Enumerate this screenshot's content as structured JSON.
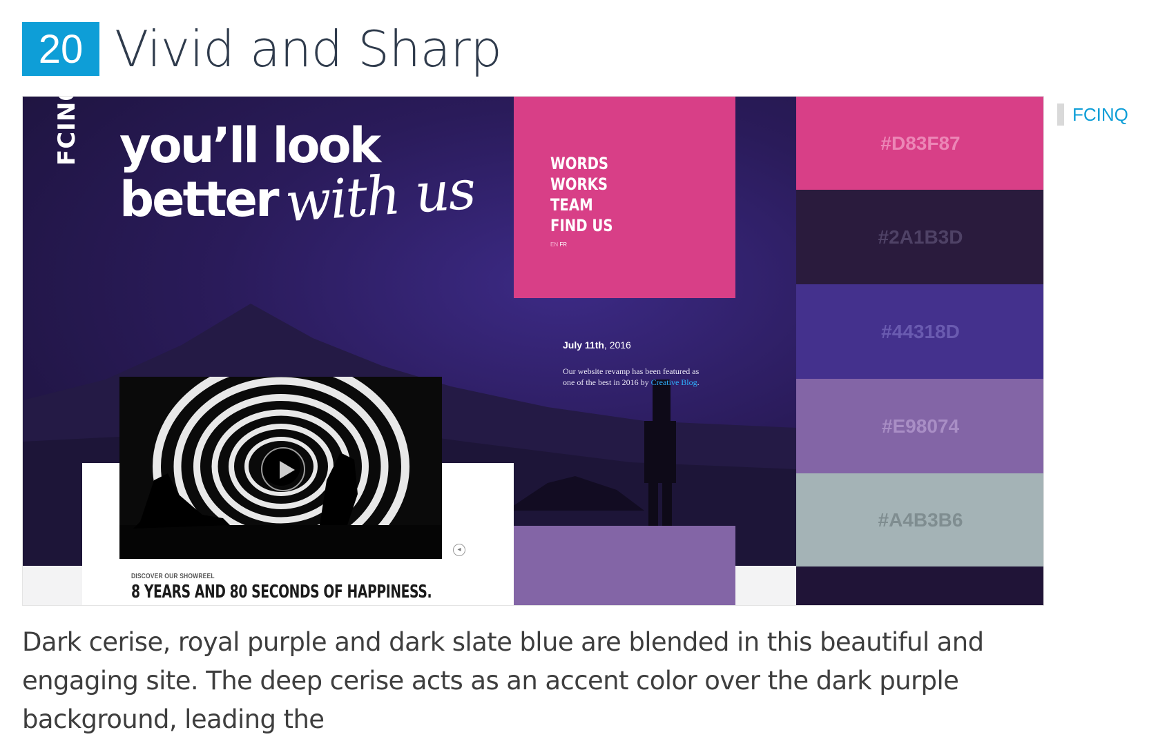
{
  "header": {
    "number": "20",
    "title": "Vivid and Sharp"
  },
  "screenshot": {
    "brand": "FCINQ",
    "headline_line1": "you’ll look",
    "headline_line2": "better",
    "headline_script": "with us",
    "menu": [
      "WORDS",
      "WORKS",
      "TEAM",
      "FIND US"
    ],
    "lang_en": "EN",
    "lang_fr": "FR",
    "news_date_bold": "July 11th",
    "news_date_rest": ", 2016",
    "news_text_before": "Our website revamp has been featured as one of the best in 2016 by ",
    "news_link": "Creative Blog",
    "news_text_after": ".",
    "reel_kicker": "DISCOVER OUR SHOWREEL",
    "reel_title": "8 YEARS AND 80 SECONDS OF HAPPINESS."
  },
  "swatches": [
    {
      "label": "#D83F87",
      "bg": "#D83F87",
      "text_color": "#ec86b6"
    },
    {
      "label": "#2A1B3D",
      "bg": "#2A1B3D",
      "text_color": "#4f4266"
    },
    {
      "label": "#44318D",
      "bg": "#44318D",
      "text_color": "#6a5bb0"
    },
    {
      "label": "#E98074",
      "bg": "#8365A6",
      "text_color": "#a98ec5"
    },
    {
      "label": "#A4B3B6",
      "bg": "#A4B3B6",
      "text_color": "#7f8d90"
    }
  ],
  "source": {
    "label": "FCINQ"
  },
  "description": "Dark cerise, royal purple and dark slate blue are blended in this beautiful and engaging site. The deep cerise acts as an accent color over the dark purple background, leading the"
}
